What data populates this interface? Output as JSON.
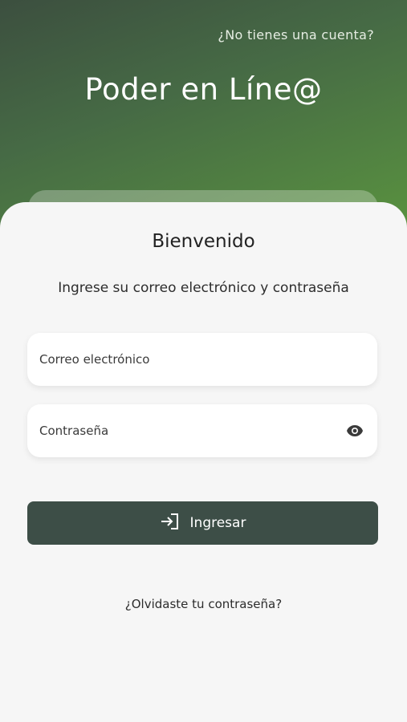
{
  "header": {
    "signup_link": "¿No tienes una cuenta?",
    "app_title": "Poder en Líne@"
  },
  "login": {
    "welcome": "Bienvenido",
    "instructions": "Ingrese su correo electrónico y contraseña",
    "email_placeholder": "Correo electrónico",
    "password_placeholder": "Contraseña",
    "password_toggle_icon": "eye-icon",
    "submit_icon": "login-icon",
    "submit_label": "Ingresar",
    "forgot_link": "¿Olvidaste tu contraseña?"
  },
  "colors": {
    "hero_gradient_start": "#3c4f3f",
    "hero_gradient_end": "#5a943f",
    "button": "#3d4e47",
    "background": "#f6f6f6"
  }
}
